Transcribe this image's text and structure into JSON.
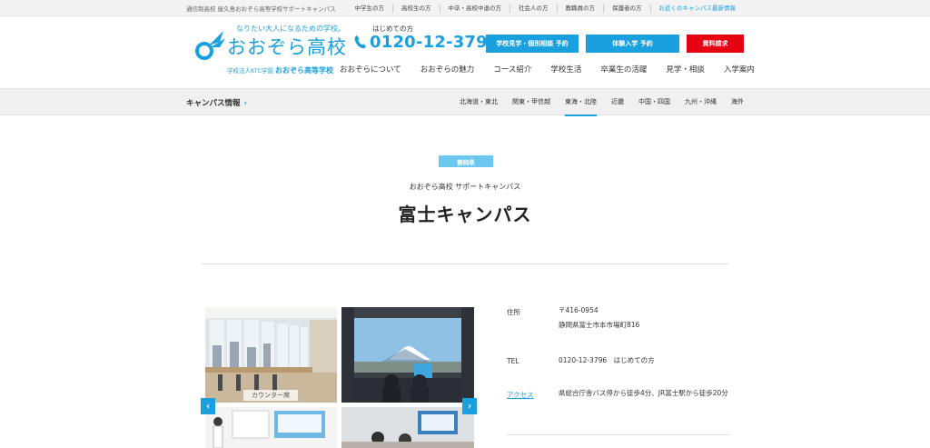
{
  "topbar": {
    "tagline": "通信制高校 屋久島おおぞら高等学校サポートキャンパス",
    "links": [
      {
        "label": "中学生の方",
        "accent": false
      },
      {
        "label": "高校生の方",
        "accent": false
      },
      {
        "label": "中卒・高校中退の方",
        "accent": false
      },
      {
        "label": "社会人の方",
        "accent": false
      },
      {
        "label": "教職員の方",
        "accent": false
      },
      {
        "label": "保護者の方",
        "accent": false
      },
      {
        "label": "お近くのキャンパス最新情報",
        "accent": true
      }
    ]
  },
  "logo": {
    "slogan": "なりたい大人になるための学校。",
    "name": "おおぞら高校",
    "sub_prefix": "学校法人KTC学園",
    "sub_name": "おおぞら高等学校"
  },
  "phone": {
    "hint": "はじめての方",
    "number": "0120-12-3796"
  },
  "buttons": {
    "visit": "学校見学・個別相談 予約",
    "trial": "体験入学 予約",
    "brochure": "資料請求"
  },
  "mainnav": [
    "おおぞらについて",
    "おおぞらの魅力",
    "コース紹介",
    "学校生活",
    "卒業生の活躍",
    "見学・相談",
    "入学案内"
  ],
  "campusbar": {
    "title": "キャンパス情報",
    "chevron": "›",
    "regions": [
      {
        "label": "北海道・東北",
        "active": false
      },
      {
        "label": "関東・甲信越",
        "active": false
      },
      {
        "label": "東海・北陸",
        "active": true
      },
      {
        "label": "近畿",
        "active": false
      },
      {
        "label": "中国・四国",
        "active": false
      },
      {
        "label": "九州・沖縄",
        "active": false
      },
      {
        "label": "海外",
        "active": false
      }
    ]
  },
  "hero": {
    "badge": "静岡県",
    "subtitle": "おおぞら高校 サポートキャンパス",
    "title": "富士キャンパス"
  },
  "gallery": {
    "caption1": "カウンター席",
    "prev": "‹",
    "next": "›"
  },
  "info": {
    "address_label": "住所",
    "postal": "〒416-0954",
    "address": "静岡県富士市本市場町816",
    "tel_label": "TEL",
    "tel_value": "0120-12-3796　はじめての方",
    "access_label": "アクセス",
    "access_value": "県総合庁舎バス停から徒歩4分、JR富士駅から徒歩20分"
  },
  "colors": {
    "accent": "#1a9fdf",
    "red": "#e50012",
    "badge": "#6cc8ee"
  }
}
